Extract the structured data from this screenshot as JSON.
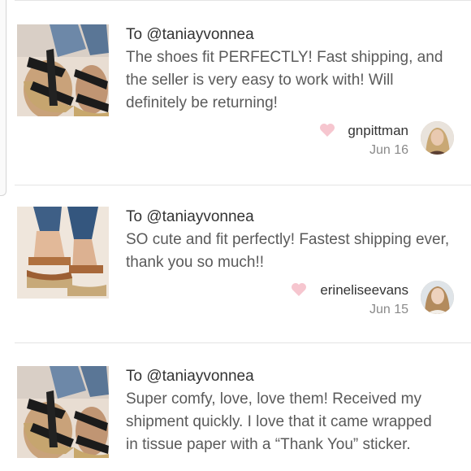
{
  "reviews": [
    {
      "to": "To @taniayvonnea",
      "text": "The shoes fit PERFECTLY! Fast shipping, and the seller is very easy to work with! Will definitely be returning!",
      "username": "gnpittman",
      "date": "Jun 16",
      "thumb": "black-cross-strap-espadrille",
      "heart_color": "#f6c6cf"
    },
    {
      "to": "To @taniayvonnea",
      "text": "SO cute and fit perfectly! Fastest shipping ever, thank you so much!!",
      "username": "erineliseevans",
      "date": "Jun 15",
      "thumb": "tan-ankle-strap-espadrille",
      "heart_color": "#f6c6cf"
    },
    {
      "to": "To @taniayvonnea",
      "text": "Super comfy, love, love them! Received my shipment quickly. I love that it came wrapped in tissue paper with a “Thank You” sticker.",
      "username": "",
      "date": "",
      "thumb": "black-cross-strap-espadrille",
      "heart_color": "#f6c6cf"
    }
  ]
}
